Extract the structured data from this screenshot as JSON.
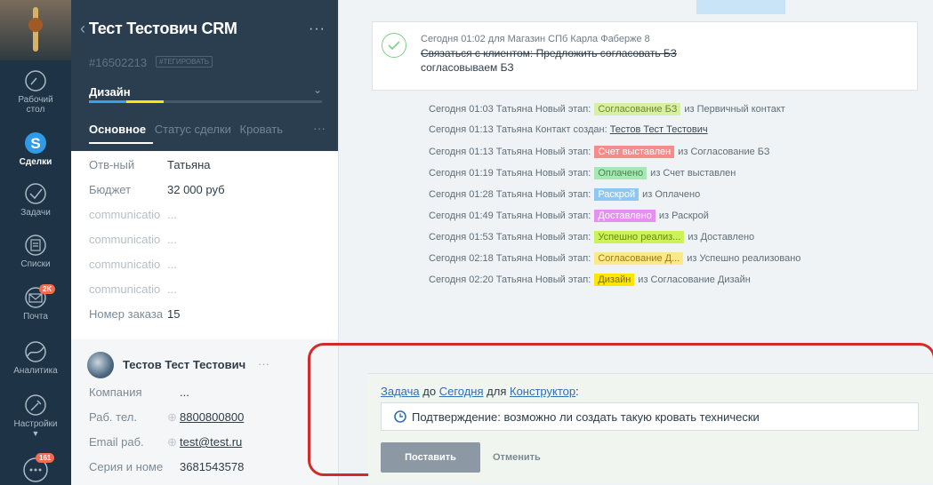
{
  "nav": {
    "items": [
      {
        "label_1": "Рабочий",
        "label_2": "стол",
        "icon": "dashboard-gauge-icon"
      },
      {
        "label": "Сделки",
        "icon": "deals-dollar-icon"
      },
      {
        "label": "Задачи",
        "icon": "tasks-check-icon"
      },
      {
        "label": "Списки",
        "icon": "lists-icon"
      },
      {
        "label": "Почта",
        "icon": "mail-icon",
        "badge": "2K"
      },
      {
        "label": "Аналитика",
        "icon": "analytics-icon"
      },
      {
        "label": "Настройки",
        "icon": "settings-wrench-icon"
      }
    ],
    "chat_badge": "161"
  },
  "deal": {
    "title": "Тест Тестович CRM",
    "id": "#16502213",
    "tag_button": "#ТЕГИРОВАТЬ",
    "pipeline": "Дизайн",
    "progress_fraction": 0.32,
    "tabs": [
      "Основное",
      "Статус сделки",
      "Кровать"
    ],
    "fields": [
      {
        "label": "Отв-ный",
        "value": "Татьяна"
      },
      {
        "label": "Бюджет",
        "value": "32 000  руб"
      },
      {
        "label": "communicatio",
        "value": "..."
      },
      {
        "label": "communicatio",
        "value": "..."
      },
      {
        "label": "communicatio",
        "value": "..."
      },
      {
        "label": "communicatio",
        "value": "..."
      },
      {
        "label": "Номер заказа",
        "value": "15"
      }
    ]
  },
  "contact": {
    "name": "Тестов Тест Тестович",
    "fields": [
      {
        "label": "Компания",
        "value": "..."
      },
      {
        "label": "Раб. тел.",
        "value": "8800800800"
      },
      {
        "label": "Email раб.",
        "value": "test@test.ru"
      },
      {
        "label": "Серия и номе",
        "value": "3681543578"
      }
    ]
  },
  "note": {
    "header": "Сегодня 01:02 для Магазин СПб Карла Фаберже 8",
    "task_done": "Связаться с клиентом: Предложить согласовать БЗ",
    "result": "согласовываем БЗ"
  },
  "events": [
    {
      "prefix": "Сегодня 01:03 Татьяна Новый этап:",
      "stage": "Согласование БЗ",
      "color": "#d8f0a6",
      "text_color": "#6c8a24",
      "suffix": "из Первичный контакт"
    },
    {
      "prefix": "Сегодня 01:13 Татьяна Контакт создан:",
      "link": "Тестов Тест Тестович"
    },
    {
      "prefix": "Сегодня 01:13 Татьяна Новый этап:",
      "stage": "Счет выставлен",
      "color": "#f58b8b",
      "text_color": "#ffffff",
      "suffix": "из Согласование БЗ"
    },
    {
      "prefix": "Сегодня 01:19 Татьяна Новый этап:",
      "stage": "Оплачено",
      "color": "#a8e6b4",
      "text_color": "#3f8a4f",
      "suffix": "из Счет выставлен"
    },
    {
      "prefix": "Сегодня 01:28 Татьяна Новый этап:",
      "stage": "Раскрой",
      "color": "#8ec8f2",
      "text_color": "#ffffff",
      "suffix": "из Оплачено"
    },
    {
      "prefix": "Сегодня 01:49 Татьяна Новый этап:",
      "stage": "Доставлено",
      "color": "#e58ff0",
      "text_color": "#ffffff",
      "suffix": "из Раскрой"
    },
    {
      "prefix": "Сегодня 01:53 Татьяна Новый этап:",
      "stage": "Успешно реализ...",
      "color": "#ccf25a",
      "text_color": "#6c8a10",
      "suffix": "из Доставлено"
    },
    {
      "prefix": "Сегодня 02:18 Татьяна Новый этап:",
      "stage": "Согласование Д...",
      "color": "#fde98a",
      "text_color": "#9a7a10",
      "suffix": "из Успешно реализовано"
    },
    {
      "prefix": "Сегодня 02:20 Татьяна Новый этап:",
      "stage": "Дизайн",
      "color": "#ffe600",
      "text_color": "#7a6a00",
      "suffix": "из Согласование Дизайн"
    }
  ],
  "task": {
    "type": "Задача",
    "when_prefix": "до",
    "when": "Сегодня",
    "for_prefix": "для",
    "for": "Конструктор",
    "colon": ":",
    "text": "Подтверждение: возможно ли создать такую кровать технически",
    "submit": "Поставить",
    "cancel": "Отменить"
  },
  "colors": {
    "nav_bg": "#1e3345",
    "card_head_bg": "#2b3e4f",
    "highlight": "#d32a2a",
    "link": "#2f6fb5"
  }
}
